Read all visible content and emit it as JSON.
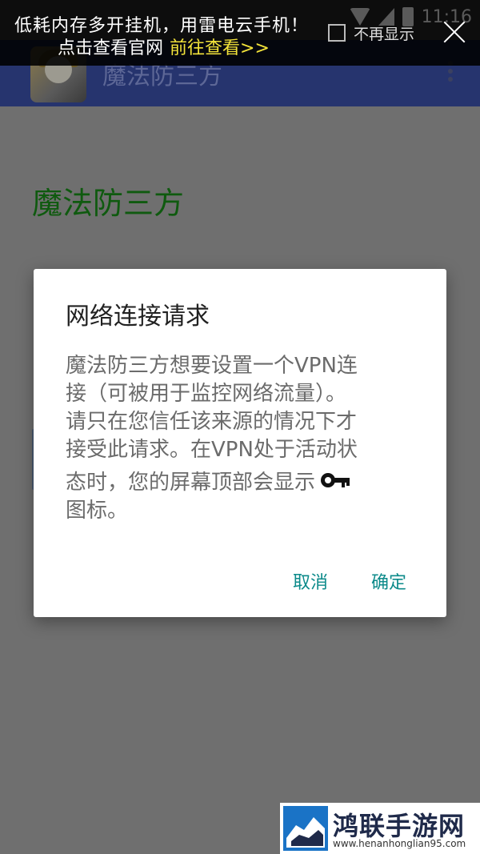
{
  "app": {
    "title": "魔法防三方",
    "content_title": "魔法防三方"
  },
  "banner": {
    "line1": "低耗内存多开挂机，用雷电云手机！",
    "line2": "点击查看官网",
    "link": "前往查看>>",
    "no_more_label": "不再显示",
    "clock": "11:16"
  },
  "dialog": {
    "title": "网络连接请求",
    "body_lines": [
      "魔法防三方想要设置一个VPN连",
      "接（可被用于监控网络流量）。",
      "请只在您信任该来源的情况下才",
      "接受此请求。在VPN处于活动状",
      "态时，您的屏幕顶部会显示",
      "图标。"
    ],
    "cancel_label": "取消",
    "ok_label": "确定"
  },
  "watermark": {
    "name": "鸿联手游网",
    "url": "www.henanhonglian95.com"
  },
  "icons": {
    "key": "key-icon",
    "close": "close-icon",
    "overflow": "overflow-menu-icon"
  }
}
